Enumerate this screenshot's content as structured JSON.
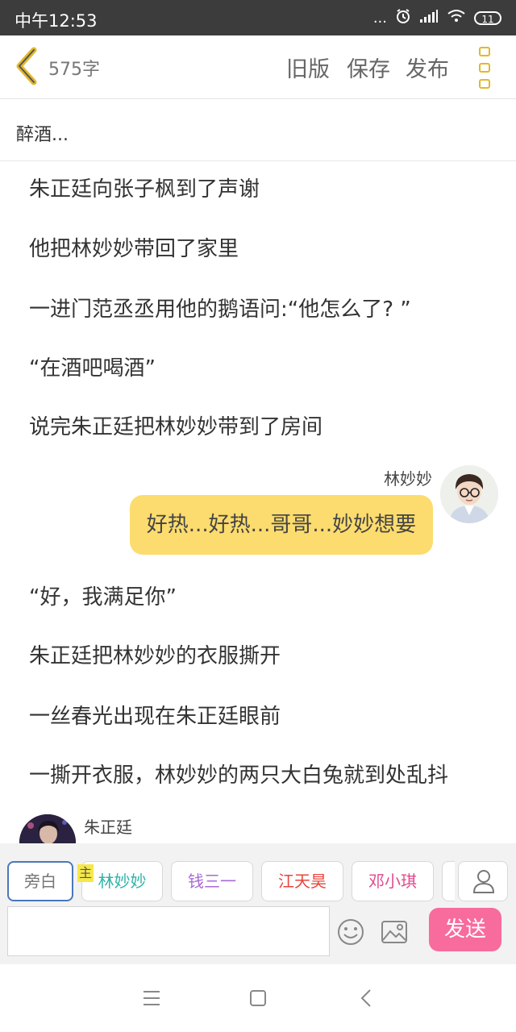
{
  "status_bar": {
    "time": "中午12:53",
    "signal_dots": "...",
    "battery": "11"
  },
  "top_bar": {
    "word_count": "575字",
    "old_version": "旧版",
    "save": "保存",
    "publish": "发布"
  },
  "story": {
    "title": "醉酒..."
  },
  "content": {
    "narration_1": "朱正廷向张子枫到了声谢",
    "narration_2": "他把林妙妙带回了家里",
    "narration_3": "一进门范丞丞用他的鹅语问:“他怎么了? ”",
    "narration_4": "“在酒吧喝酒”",
    "narration_5": "说完朱正廷把林妙妙带到了房间",
    "dialogue_1": {
      "speaker": "林妙妙",
      "text": "好热...好热...哥哥...妙妙想要"
    },
    "narration_6": "“好，我满足你”",
    "narration_7": "朱正廷把林妙妙的衣服撕开",
    "narration_8": "一丝春光出现在朱正廷眼前",
    "narration_9": "一撕开衣服，林妙妙的两只大白兔就到处乱抖",
    "dialogue_2": {
      "speaker": "朱正廷"
    }
  },
  "characters": [
    {
      "label": "旁白",
      "color": "#777777"
    },
    {
      "label": "林妙妙",
      "color": "#2fb3a8"
    },
    {
      "label": "钱三一",
      "color": "#a86ad6"
    },
    {
      "label": "江天昊",
      "color": "#e8453c"
    },
    {
      "label": "邓小琪",
      "color": "#e04a8e"
    }
  ],
  "main_badge": "主",
  "composer": {
    "input_value": "",
    "send_label": "发送"
  },
  "colors": {
    "accent_yellow": "#fcdc6e",
    "send_pink": "#f86b9d",
    "menu_icon": "#e2b82c"
  }
}
